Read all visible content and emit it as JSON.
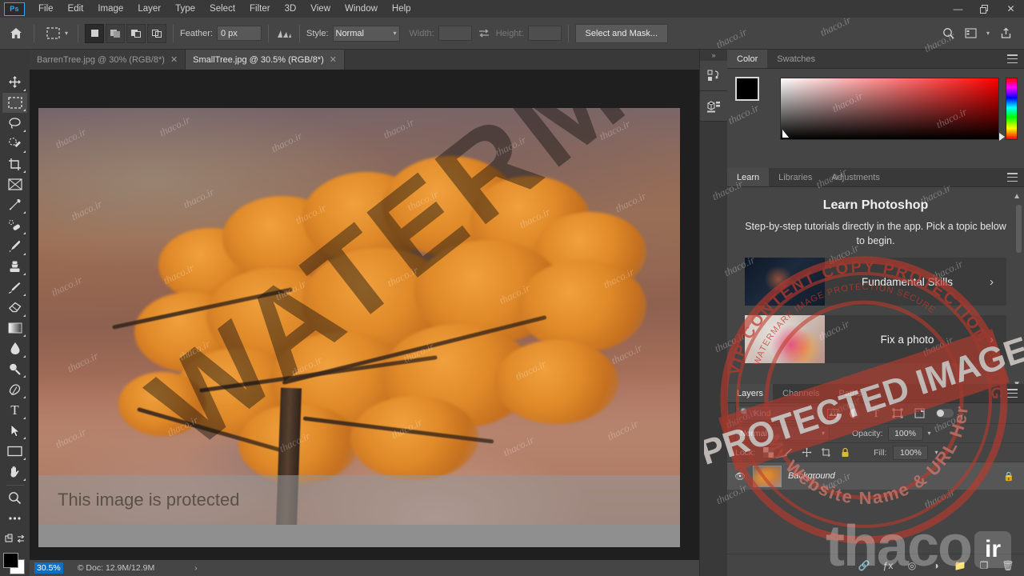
{
  "app": {
    "name": "Adobe Photoshop",
    "logo_text": "Ps"
  },
  "menubar": {
    "items": [
      {
        "label": "File"
      },
      {
        "label": "Edit"
      },
      {
        "label": "Image"
      },
      {
        "label": "Layer"
      },
      {
        "label": "Type"
      },
      {
        "label": "Select"
      },
      {
        "label": "Filter"
      },
      {
        "label": "3D"
      },
      {
        "label": "View"
      },
      {
        "label": "Window"
      },
      {
        "label": "Help"
      }
    ],
    "window_controls": {
      "minimize": "—",
      "restore": "❐",
      "close": "✕"
    }
  },
  "options_bar": {
    "home_icon": "home-icon",
    "tool_preset_icon": "marquee-tool-icon",
    "selection_modes": [
      {
        "name": "new-selection",
        "active": true
      },
      {
        "name": "add-to-selection",
        "active": false
      },
      {
        "name": "subtract-from-selection",
        "active": false
      },
      {
        "name": "intersect-with-selection",
        "active": false
      }
    ],
    "feather_label": "Feather:",
    "feather_value": "0 px",
    "antialias_icon": "anti-alias-icon",
    "style_label": "Style:",
    "style_value": "Normal",
    "width_label": "Width:",
    "width_value": "",
    "swap_icon": "swap-width-height-icon",
    "height_label": "Height:",
    "height_value": "",
    "select_and_mask_label": "Select and Mask...",
    "right_icons": [
      {
        "name": "search-icon"
      },
      {
        "name": "workspace-icon"
      },
      {
        "name": "chevron-down-icon"
      },
      {
        "name": "share-icon"
      }
    ]
  },
  "tabs": [
    {
      "label": "BarrenTree.jpg @ 30% (RGB/8*)",
      "active": false,
      "close": "✕"
    },
    {
      "label": "SmallTree.jpg @ 30.5% (RGB/8*)",
      "active": true,
      "close": "✕"
    }
  ],
  "toolbar": {
    "tools": [
      {
        "name": "move-tool",
        "glyph": "✥",
        "active": false,
        "has_flyout": true
      },
      {
        "name": "rectangular-marquee-tool",
        "glyph": "⬚",
        "active": true,
        "has_flyout": true
      },
      {
        "name": "lasso-tool",
        "glyph": "⬭",
        "active": false,
        "has_flyout": true
      },
      {
        "name": "quick-selection-tool",
        "glyph": "✎",
        "active": false,
        "has_flyout": true
      },
      {
        "name": "crop-tool",
        "glyph": "⌗",
        "active": false,
        "has_flyout": true
      },
      {
        "name": "frame-tool",
        "glyph": "⌧",
        "active": false,
        "has_flyout": false
      },
      {
        "name": "eyedropper-tool",
        "glyph": "✐",
        "active": false,
        "has_flyout": true
      },
      {
        "name": "spot-healing-brush-tool",
        "glyph": "✒",
        "active": false,
        "has_flyout": true
      },
      {
        "name": "brush-tool",
        "glyph": "✏",
        "active": false,
        "has_flyout": true
      },
      {
        "name": "clone-stamp-tool",
        "glyph": "⚓",
        "active": false,
        "has_flyout": true
      },
      {
        "name": "history-brush-tool",
        "glyph": "✐",
        "active": false,
        "has_flyout": true
      },
      {
        "name": "eraser-tool",
        "glyph": "▱",
        "active": false,
        "has_flyout": true
      },
      {
        "name": "gradient-tool",
        "glyph": "▤",
        "active": false,
        "has_flyout": true
      },
      {
        "name": "blur-tool",
        "glyph": "●",
        "active": false,
        "has_flyout": true
      },
      {
        "name": "dodge-tool",
        "glyph": "⚲",
        "active": false,
        "has_flyout": true
      },
      {
        "name": "pen-tool",
        "glyph": "✑",
        "active": false,
        "has_flyout": true
      },
      {
        "name": "horizontal-type-tool",
        "glyph": "T",
        "active": false,
        "has_flyout": true
      },
      {
        "name": "path-selection-tool",
        "glyph": "➤",
        "active": false,
        "has_flyout": true
      },
      {
        "name": "rectangle-tool",
        "glyph": "▭",
        "active": false,
        "has_flyout": true
      },
      {
        "name": "hand-tool",
        "glyph": "✋",
        "active": false,
        "has_flyout": true
      },
      {
        "name": "zoom-tool",
        "glyph": "⚲",
        "active": false,
        "has_flyout": false
      },
      {
        "name": "edit-toolbar-tool",
        "glyph": "⋯",
        "active": false,
        "has_flyout": false
      },
      {
        "name": "default-colors-tool",
        "glyph": "❐",
        "active": false,
        "has_flyout": false
      }
    ],
    "foreground_color": "#000000",
    "background_color": "#ffffff"
  },
  "canvas": {
    "document_name": "SmallTree.jpg",
    "watermark_diagonal": "WATERMARK",
    "watermark_tile": "thaco.ir",
    "protected_banner": "This image is protected"
  },
  "statusbar": {
    "zoom": "30.5%",
    "doc_info": "© Doc: 12.9M/12.9M",
    "expand_icon": "›"
  },
  "dock_strip": {
    "collapse_icon": "»",
    "buttons": [
      {
        "name": "history-panel-icon"
      },
      {
        "name": "3d-panel-icon"
      }
    ]
  },
  "color_panel": {
    "tabs": [
      {
        "label": "Color",
        "active": true
      },
      {
        "label": "Swatches",
        "active": false
      }
    ],
    "menu_icon": "panel-menu-icon",
    "foreground": "#000000",
    "background": "#ffffff"
  },
  "learn_panel": {
    "tabs": [
      {
        "label": "Learn",
        "active": true
      },
      {
        "label": "Libraries",
        "active": false
      },
      {
        "label": "Adjustments",
        "active": false
      }
    ],
    "menu_icon": "panel-menu-icon",
    "title": "Learn Photoshop",
    "subtitle": "Step-by-step tutorials directly in the app. Pick a topic below to begin.",
    "cards": [
      {
        "label": "Fundamental Skills",
        "arrow": "›"
      },
      {
        "label": "Fix a photo",
        "arrow": "›"
      }
    ]
  },
  "layers_panel": {
    "tabs": [
      {
        "label": "Layers",
        "active": true
      },
      {
        "label": "Channels",
        "active": false
      },
      {
        "label": "Paths",
        "active": false
      }
    ],
    "menu_icon": "panel-menu-icon",
    "filter_placeholder": "Kind",
    "filter_icons": [
      {
        "name": "filter-pixel-icon"
      },
      {
        "name": "filter-adjustment-icon"
      },
      {
        "name": "filter-type-icon"
      },
      {
        "name": "filter-shape-icon"
      },
      {
        "name": "filter-smart-object-icon"
      }
    ],
    "filter_toggle": "filter-enable-toggle",
    "blend_mode": "Normal",
    "opacity_label": "Opacity:",
    "opacity_value": "100%",
    "lock_label": "Lock:",
    "lock_icons": [
      {
        "name": "lock-transparent-pixels-icon"
      },
      {
        "name": "lock-image-pixels-icon"
      },
      {
        "name": "lock-position-icon"
      },
      {
        "name": "lock-artboard-nesting-icon"
      },
      {
        "name": "lock-all-icon"
      }
    ],
    "fill_label": "Fill:",
    "fill_value": "100%",
    "layers": [
      {
        "name": "Background",
        "visible": true,
        "locked": true
      }
    ],
    "footer_icons": [
      {
        "name": "link-layers-icon"
      },
      {
        "name": "layer-style-icon"
      },
      {
        "name": "layer-mask-icon"
      },
      {
        "name": "adjustment-layer-icon"
      },
      {
        "name": "new-group-icon"
      },
      {
        "name": "new-layer-icon"
      },
      {
        "name": "delete-layer-icon"
      }
    ]
  },
  "watermarks": {
    "stamp_outer_top": "VIP CONTENT COPY PROTECTION PLUGIN",
    "stamp_center": "PROTECTED IMAGE",
    "stamp_inner_bottom": "My Website Name & URL Here",
    "logo_word": "thaco",
    "logo_tld": "ir",
    "tile_text": "thaco.ir",
    "stamp_color": "#c0392b"
  }
}
